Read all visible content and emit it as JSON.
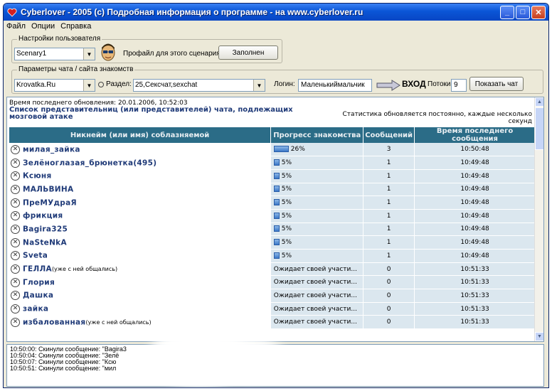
{
  "window": {
    "title": "Cyberlover - 2005 (c) Подробная информация о программе - на www.cyberlover.ru",
    "min_label": "_",
    "max_label": "□",
    "close_label": "✕"
  },
  "menu": [
    "Файл",
    "Опции",
    "Справка"
  ],
  "user_settings": {
    "group_label": "Настройки пользователя",
    "scenario_value": "Scenary1",
    "profile_label": "Профайл для этого сценария:",
    "filled_button": "Заполнен"
  },
  "chat_params": {
    "group_label": "Параметры чата / сайта знакомств",
    "site_value": "Krovatka.Ru",
    "section_label": "Раздел:",
    "section_value": "25,Сексчат,sexchat",
    "login_label": "Логин:",
    "login_value": "Маленькиймальчик",
    "enter_button": "ВХОД",
    "threads_label": "Потоки:",
    "threads_value": "9",
    "show_chat_button": "Показать чат"
  },
  "content": {
    "last_update": "Время последнего обновления: 20.01.2006, 10:52:03",
    "heading": "Список представительниц (или представителей) чата, подлежащих мозговой атаке",
    "stats_note": "Статистика обновляется постоянно, каждые несколько секунд"
  },
  "table": {
    "headers": [
      "Никнейм (или имя) соблазняемой",
      "Прогресс знакомства",
      "Сообщений",
      "Время последнего сообщения"
    ],
    "rows": [
      {
        "nick": "милая_зайка",
        "note": "",
        "progress_text": "26%",
        "progress": 26,
        "messages": "3",
        "time": "10:50:48"
      },
      {
        "nick": "Зелёноглазая_брюнетка(495)",
        "note": "",
        "progress_text": "5%",
        "progress": 5,
        "messages": "1",
        "time": "10:49:48"
      },
      {
        "nick": "Ксюня",
        "note": "",
        "progress_text": "5%",
        "progress": 5,
        "messages": "1",
        "time": "10:49:48"
      },
      {
        "nick": "МАЛЬВИНА",
        "note": "",
        "progress_text": "5%",
        "progress": 5,
        "messages": "1",
        "time": "10:49:48"
      },
      {
        "nick": "ПреМУдраЯ",
        "note": "",
        "progress_text": "5%",
        "progress": 5,
        "messages": "1",
        "time": "10:49:48"
      },
      {
        "nick": "фрикция",
        "note": "",
        "progress_text": "5%",
        "progress": 5,
        "messages": "1",
        "time": "10:49:48"
      },
      {
        "nick": "Bagira325",
        "note": "",
        "progress_text": "5%",
        "progress": 5,
        "messages": "1",
        "time": "10:49:48"
      },
      {
        "nick": "NaSteNkA",
        "note": "",
        "progress_text": "5%",
        "progress": 5,
        "messages": "1",
        "time": "10:49:48"
      },
      {
        "nick": "Sveta",
        "note": "",
        "progress_text": "5%",
        "progress": 5,
        "messages": "1",
        "time": "10:49:48"
      },
      {
        "nick": "ГЕЛЛА",
        "note": "(уже с ней общались)",
        "progress_text": "Ожидает своей участи...",
        "progress": null,
        "messages": "0",
        "time": "10:51:33"
      },
      {
        "nick": "Глория",
        "note": "",
        "progress_text": "Ожидает своей участи...",
        "progress": null,
        "messages": "0",
        "time": "10:51:33"
      },
      {
        "nick": "Дашка",
        "note": "",
        "progress_text": "Ожидает своей участи...",
        "progress": null,
        "messages": "0",
        "time": "10:51:33"
      },
      {
        "nick": "зайка",
        "note": "",
        "progress_text": "Ожидает своей участи...",
        "progress": null,
        "messages": "0",
        "time": "10:51:33"
      },
      {
        "nick": "избалованная",
        "note": "(уже с ней общались)",
        "progress_text": "Ожидает своей участи...",
        "progress": null,
        "messages": "0",
        "time": "10:51:33"
      }
    ]
  },
  "log": [
    "10:50:00: Скинули сообщение: \"Bagira3",
    "10:50:04: Скинули сообщение: \"Зелё",
    "10:50:07: Скинули сообщение: \"Ксю",
    "10:50:51: Скинули сообщение: \"мил"
  ],
  "colors": {
    "header_bg": "#2b6c87",
    "nick_color": "#1f3a78",
    "cell_bg": "#dbe7ef",
    "titlebar": "#0a55d6"
  }
}
